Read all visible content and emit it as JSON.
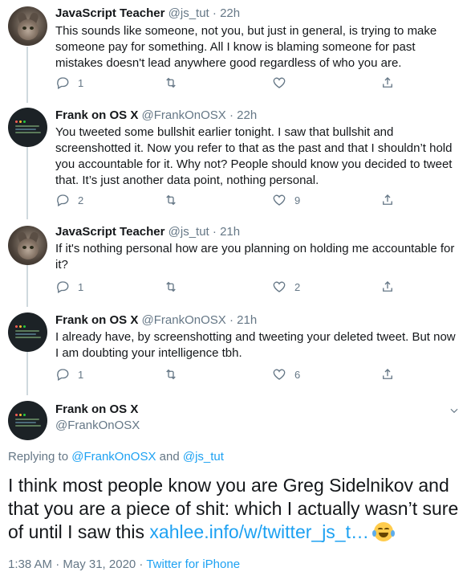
{
  "colors": {
    "link": "#1da1f2",
    "muted": "#657786",
    "text": "#14171a",
    "thread_line": "#cfd9de"
  },
  "tweets": [
    {
      "name": "JavaScript Teacher",
      "handle": "@js_tut",
      "time": "· 22h",
      "text": "This sounds like someone, not you, but just in general, is trying to make someone pay for something. All I know is blaming someone for past mistakes doesn't lead anywhere good regardless of who you are.",
      "replies": "1",
      "retweets": "",
      "likes": ""
    },
    {
      "name": "Frank on OS X",
      "handle": "@FrankOnOSX",
      "time": "· 22h",
      "text": "You tweeted some bullshit earlier tonight. I saw that bullshit and screenshotted it. Now you refer to that as the past and that I shouldn’t hold you accountable for it. Why not? People should know you decided to tweet that. It’s just another data point, nothing personal.",
      "replies": "2",
      "retweets": "",
      "likes": "9"
    },
    {
      "name": "JavaScript Teacher",
      "handle": "@js_tut",
      "time": "· 21h",
      "text": "If it's nothing personal how are you planning on holding me accountable for it?",
      "replies": "1",
      "retweets": "",
      "likes": "2"
    },
    {
      "name": "Frank on OS X",
      "handle": "@FrankOnOSX",
      "time": "· 21h",
      "text": "I already have, by screenshotting and tweeting your deleted tweet. But now I am doubting your intelligence tbh.",
      "replies": "1",
      "retweets": "",
      "likes": "6"
    }
  ],
  "main": {
    "name": "Frank on OS X",
    "handle": "@FrankOnOSX",
    "replying_prefix": "Replying to ",
    "replying_to_1": "@FrankOnOSX",
    "replying_and": " and ",
    "replying_to_2": "@js_tut",
    "text": "I think most people know you are Greg Sidelnikov and that you are a piece of shit: which I actually wasn’t sure of until I saw this ",
    "link": "xahlee.info/w/twitter_js_t…",
    "emoji": "face-with-tears-of-joy",
    "timestamp": "1:38 AM · May 31, 2020 · ",
    "source": "Twitter for iPhone"
  },
  "icons": {
    "reply": "reply-icon",
    "retweet": "retweet-icon",
    "like": "heart-icon",
    "share": "share-icon",
    "more": "chevron-down-icon"
  }
}
